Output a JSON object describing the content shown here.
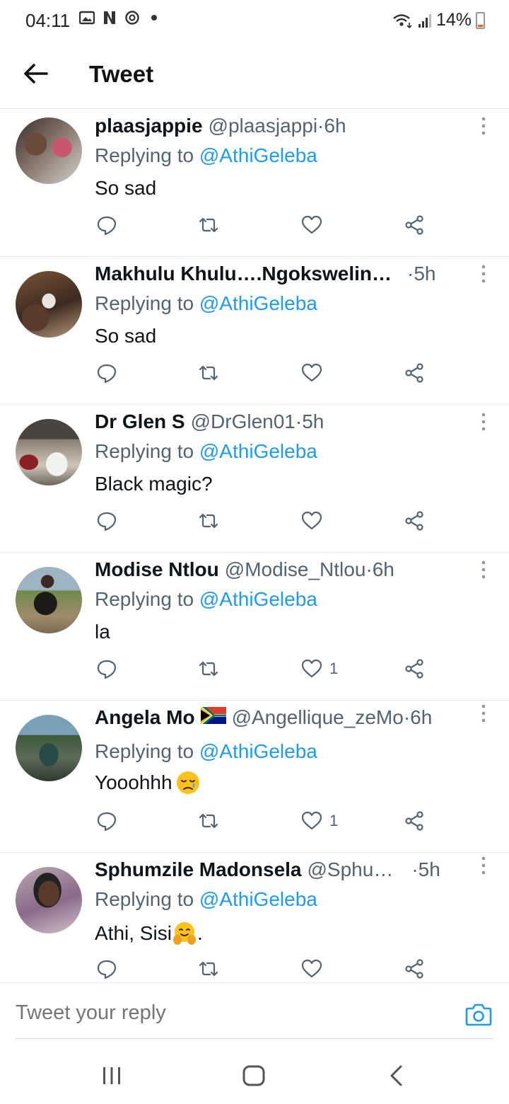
{
  "status_bar": {
    "time": "04:11",
    "battery": "14%",
    "icons": [
      "gallery-icon",
      "netflix-icon",
      "sync-icon",
      "wifi-icon",
      "signal-icon",
      "battery-icon"
    ]
  },
  "header": {
    "title": "Tweet",
    "back_icon": "arrow-left-icon"
  },
  "replying_prefix": "Replying to",
  "tweets": [
    {
      "name": "plaasjappie",
      "handle": "@plaasjappi",
      "sep": " · ",
      "time": "6h",
      "replying_to": "@AthiGeleba",
      "text": "So sad",
      "likes": ""
    },
    {
      "name": "Makhulu Khulu….Ngokswelin…",
      "handle": "",
      "sep": " · ",
      "time": "5h",
      "replying_to": "@AthiGeleba",
      "text": "So sad",
      "likes": ""
    },
    {
      "name": "Dr Glen S",
      "handle": "@DrGlen01",
      "sep": " · ",
      "time": "5h",
      "replying_to": "@AthiGeleba",
      "text": "Black magic?",
      "likes": ""
    },
    {
      "name": "Modise Ntlou",
      "handle": "@Modise_Ntlou",
      "sep": " · ",
      "time": "6h",
      "replying_to": "@AthiGeleba",
      "text": "la",
      "likes": "1"
    },
    {
      "name": "Angela Mo",
      "handle": "@Angellique_zeMo",
      "sep": " · ",
      "time": "6h",
      "replying_to": "@AthiGeleba",
      "text": "Yooohhh",
      "likes": "1",
      "name_icon": "south-africa-flag-icon",
      "text_icon": "sad-relieved-face-emoji"
    },
    {
      "name": "Sphumzile Madonsela",
      "handle": "@Sphu…",
      "sep": " · ",
      "time": "5h",
      "replying_to": "@AthiGeleba",
      "text": "Athi, Sisi",
      "text_suffix": ".",
      "likes": "",
      "text_icon": "hugging-face-emoji"
    }
  ],
  "reply_bar": {
    "placeholder": "Tweet your reply",
    "camera_icon": "camera-icon"
  },
  "nav_bar": {
    "icons": [
      "recent-apps-icon",
      "home-icon",
      "back-nav-icon"
    ]
  },
  "colors": {
    "link": "#1d9bf0",
    "secondary_text": "#536471",
    "divider": "#e6e6e6",
    "battery": "#e8632d"
  }
}
